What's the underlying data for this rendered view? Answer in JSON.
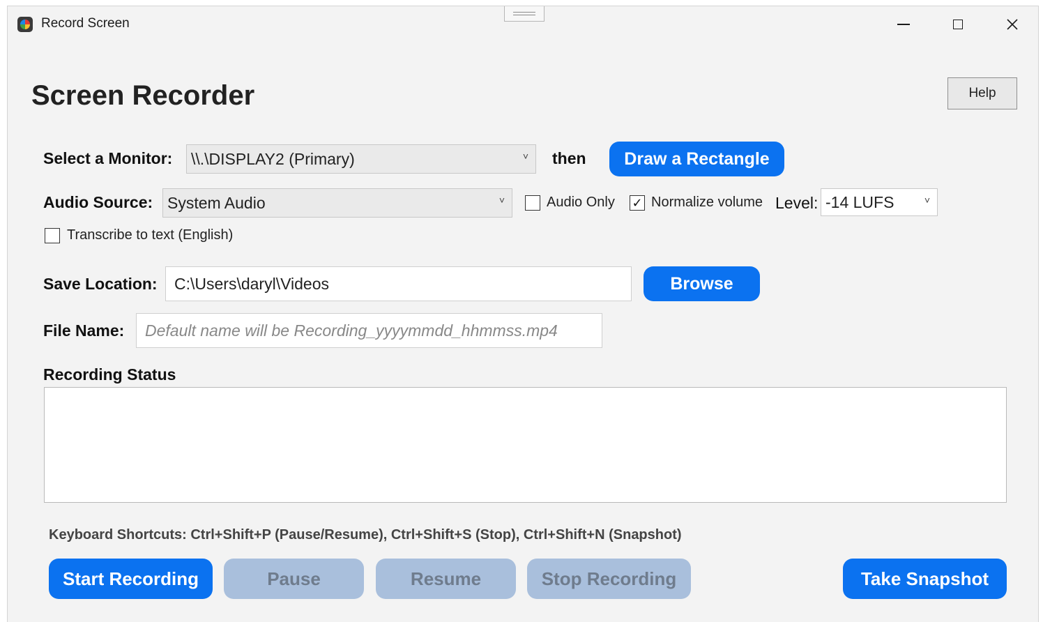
{
  "window": {
    "title": "Record Screen"
  },
  "header": {
    "title": "Screen Recorder",
    "help_label": "Help"
  },
  "monitor": {
    "label": "Select a Monitor:",
    "value": "\\\\.\\DISPLAY2 (Primary)",
    "then_label": "then",
    "draw_button": "Draw a Rectangle"
  },
  "audio": {
    "label": "Audio Source:",
    "value": "System Audio",
    "audio_only_label": "Audio Only",
    "audio_only_checked": false,
    "normalize_label": "Normalize volume",
    "normalize_checked": true,
    "level_label": "Level:",
    "level_value": "-14 LUFS"
  },
  "transcribe": {
    "label": "Transcribe to text (English)",
    "checked": false
  },
  "save": {
    "label": "Save Location:",
    "value": "C:\\Users\\daryl\\Videos",
    "browse_label": "Browse"
  },
  "file": {
    "label": "File Name:",
    "placeholder": "Default name will be Recording_yyyymmdd_hhmmss.mp4"
  },
  "status": {
    "label": "Recording Status",
    "text": ""
  },
  "shortcuts": {
    "text": "Keyboard Shortcuts: Ctrl+Shift+P (Pause/Resume), Ctrl+Shift+S (Stop), Ctrl+Shift+N (Snapshot)"
  },
  "controls": {
    "start": "Start Recording",
    "pause": "Pause",
    "resume": "Resume",
    "stop": "Stop Recording",
    "snapshot": "Take Snapshot"
  },
  "colors": {
    "accent": "#0b72f0",
    "disabled": "#a9bfdc",
    "window_bg": "#f3f3f3"
  },
  "icons": {
    "app": "record-screen-app-icon",
    "checked": "check-icon",
    "dropdown": "chevron-down-icon"
  }
}
